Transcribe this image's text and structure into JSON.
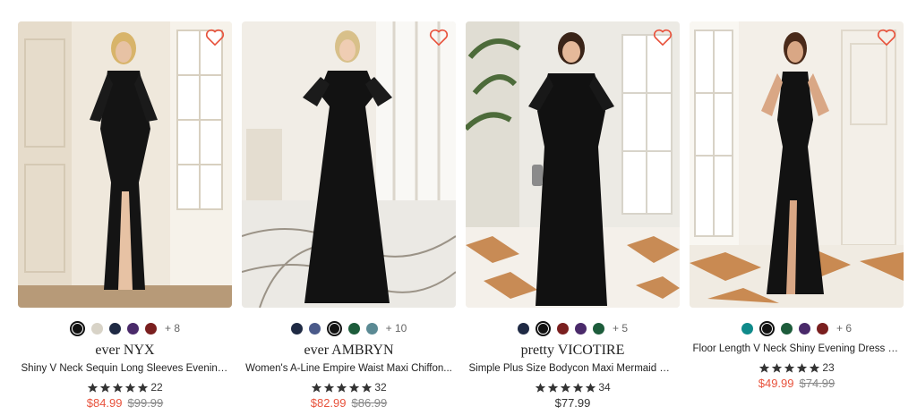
{
  "products": [
    {
      "colors": [
        "#111111",
        "#d8d3c7",
        "#1f2a44",
        "#4a2a6a",
        "#7a1f1f"
      ],
      "selected": 0,
      "more": "+ 8",
      "brand": "ever NYX",
      "name": "Shiny V Neck Sequin Long Sleeves Evening Dress",
      "rating": 5,
      "reviews": "22",
      "price": "$84.99",
      "original_price": "$99.99",
      "on_sale": true
    },
    {
      "colors": [
        "#1f2a44",
        "#4b5a8a",
        "#111111",
        "#1d5c3b",
        "#5b8a94"
      ],
      "selected": 2,
      "more": "+ 10",
      "brand": "ever AMBRYN",
      "name": "Women's A-Line Empire Waist Maxi Chiffon...",
      "rating": 5,
      "reviews": "32",
      "price": "$82.99",
      "original_price": "$86.99",
      "on_sale": true
    },
    {
      "colors": [
        "#1f2a44",
        "#111111",
        "#7a1f1f",
        "#4a2a6a",
        "#1d5c3b"
      ],
      "selected": 1,
      "more": "+ 5",
      "brand": "pretty VICOTIRE",
      "name": "Simple Plus Size Bodycon Maxi Mermaid Weddi...",
      "rating": 5,
      "reviews": "34",
      "price": "$77.99",
      "original_price": "",
      "on_sale": false
    },
    {
      "colors": [
        "#0f8a8a",
        "#111111",
        "#1d5c3b",
        "#4a2a6a",
        "#7a1f1f"
      ],
      "selected": 1,
      "more": "+ 6",
      "brand": "",
      "name": "Floor Length V Neck Shiny Evening Dress with...",
      "rating": 5,
      "reviews": "23",
      "price": "$49.99",
      "original_price": "$74.99",
      "on_sale": true
    }
  ],
  "icons": {
    "favorite": "heart-outline-icon",
    "star": "star-icon"
  },
  "accent_color": "#e8533d"
}
